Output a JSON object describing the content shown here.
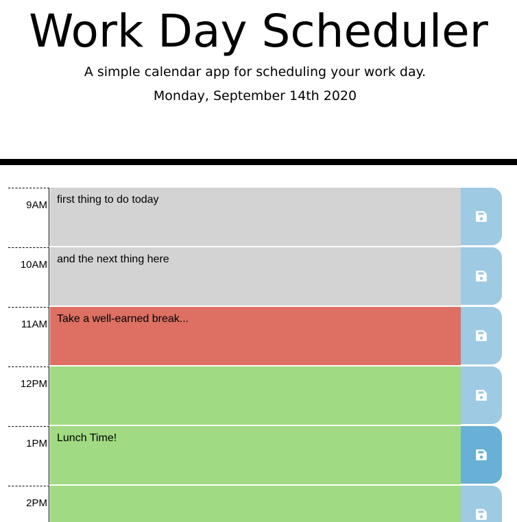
{
  "header": {
    "title": "Work Day Scheduler",
    "lead": "A simple calendar app for scheduling your work day.",
    "current_day": "Monday, September 14th 2020"
  },
  "colors": {
    "past": "#d3d3d3",
    "present": "#de6f63",
    "future": "#a0da82",
    "save_button": "#9ecae3",
    "save_button_hover": "#68b0d6"
  },
  "save_icon": "floppy-disk-icon",
  "rows": [
    {
      "hour": "9AM",
      "text": "first thing to do today",
      "state": "past"
    },
    {
      "hour": "10AM",
      "text": "and the next thing here",
      "state": "past"
    },
    {
      "hour": "11AM",
      "text": "Take a well-earned break...",
      "state": "present"
    },
    {
      "hour": "12PM",
      "text": "",
      "state": "future"
    },
    {
      "hour": "1PM",
      "text": "Lunch Time!",
      "state": "future"
    },
    {
      "hour": "2PM",
      "text": "",
      "state": "future"
    }
  ]
}
